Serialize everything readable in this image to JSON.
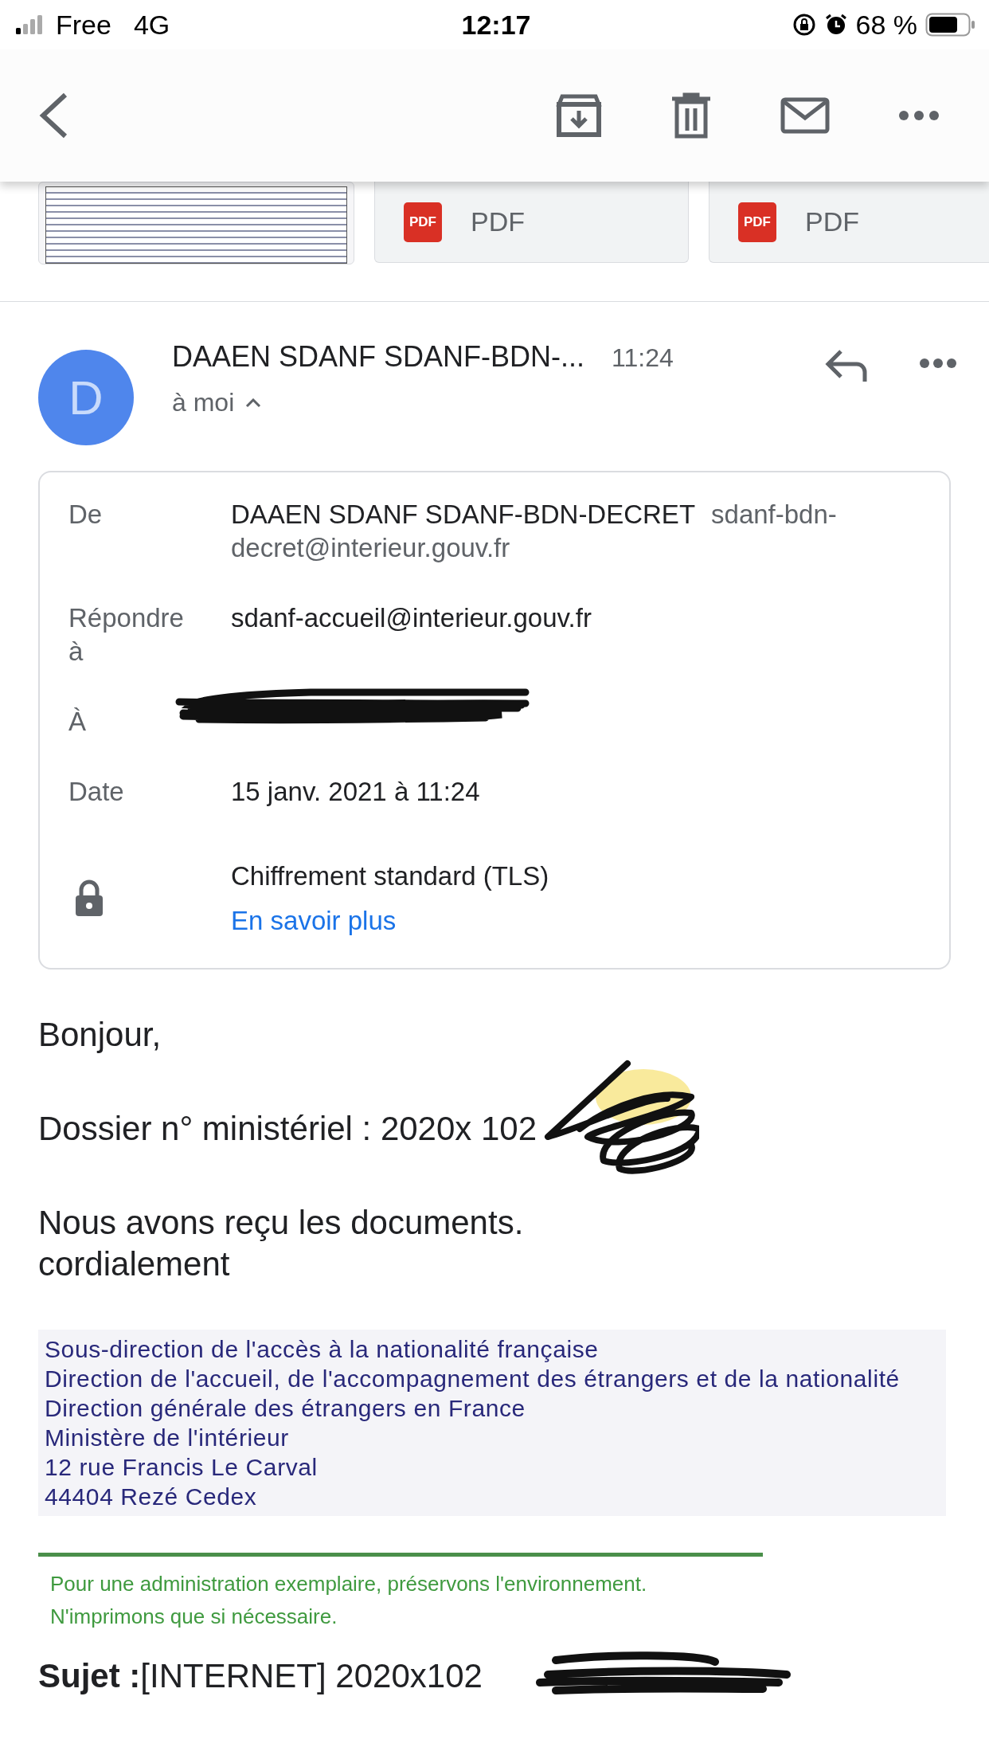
{
  "status_bar": {
    "carrier": "Free",
    "network": "4G",
    "time": "12:17",
    "battery": "68 %"
  },
  "attachments": [
    {
      "kind": "image"
    },
    {
      "kind": "pdf",
      "badge": "PDF",
      "type_label": "PDF"
    },
    {
      "kind": "pdf",
      "badge": "PDF",
      "type_label": "PDF"
    }
  ],
  "message": {
    "avatar_letter": "D",
    "sender": "DAAEN SDANF SDANF-BDN-...",
    "time": "11:24",
    "recipient": "à moi",
    "expanded": true
  },
  "details": {
    "rows": [
      {
        "kind": "sender",
        "label": "De",
        "name": "DAAEN SDANF SDANF-BDN-DECRET",
        "email": "sdanf-bdn-decret@interieur.gouv.fr"
      },
      {
        "kind": "text",
        "label": "Répondre à",
        "value": "sdanf-accueil@interieur.gouv.fr"
      },
      {
        "kind": "redacted",
        "label": "À"
      },
      {
        "kind": "text",
        "label": "Date",
        "value": "15 janv. 2021 à 11:24"
      }
    ],
    "security": {
      "text": "Chiffrement standard (TLS)",
      "link": "En savoir plus"
    }
  },
  "body": [
    {
      "lines": [
        "Bonjour,"
      ],
      "redacted": false
    },
    {
      "lines": [
        "Dossier n° ministériel : 2020x 102"
      ],
      "redacted": true
    },
    {
      "lines": [
        "Nous avons reçu les documents.",
        "cordialement"
      ],
      "redacted": false
    }
  ],
  "signature": [
    "Sous-direction de l'accès à la nationalité française",
    "Direction de l'accueil, de l'accompagnement des étrangers et de la nationalité",
    "Direction générale des étrangers en France",
    "Ministère de l'intérieur",
    "12 rue Francis Le Carval",
    "44404 Rezé Cedex"
  ],
  "footer": [
    "Pour une administration exemplaire, préservons l'environnement.",
    "N'imprimons que si nécessaire."
  ],
  "subject": {
    "label": "Sujet :",
    "value": "[INTERNET] 2020x102",
    "redacted": true
  }
}
